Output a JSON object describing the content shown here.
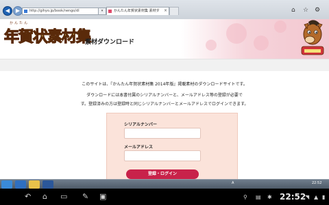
{
  "browser": {
    "address": "http://gihyo.jp/book/nengo/dl",
    "tab_title": "かんたん年賀状素材集 素材ダウ...",
    "tab_close": "×",
    "tools_symbol": "▾",
    "toolbar_icons": [
      "home-icon",
      "star-icon",
      "gear-icon"
    ]
  },
  "header": {
    "logo_ruby": "かんたん",
    "logo_text": "年賀状素材集",
    "page_title": "素材ダウンロード"
  },
  "main": {
    "intro_line1": "このサイトは、『かんたん年賀状素材集 2014年版』掲載素材のダウンロードサイトです。",
    "intro_line2": "ダウンロードには本書付属のシリアルナンバーと、メールアドレス等の登録が必要で",
    "intro_line3": "す。登録済みの方は登録時と同じシリアルナンバーとメールアドレスでログインできます。"
  },
  "login": {
    "serial_label": "シリアルナンバー",
    "serial_value": "",
    "email_label": "メールアドレス",
    "email_value": "",
    "submit_label": "登録・ログイン"
  },
  "taskbar": {
    "tray_time": "22:52",
    "tray_lang": "A"
  },
  "android": {
    "clock": "22:52"
  },
  "colors": {
    "accent": "#c8224a",
    "form_bg": "#fbe3da",
    "header_pink": "#f2c6cf"
  }
}
